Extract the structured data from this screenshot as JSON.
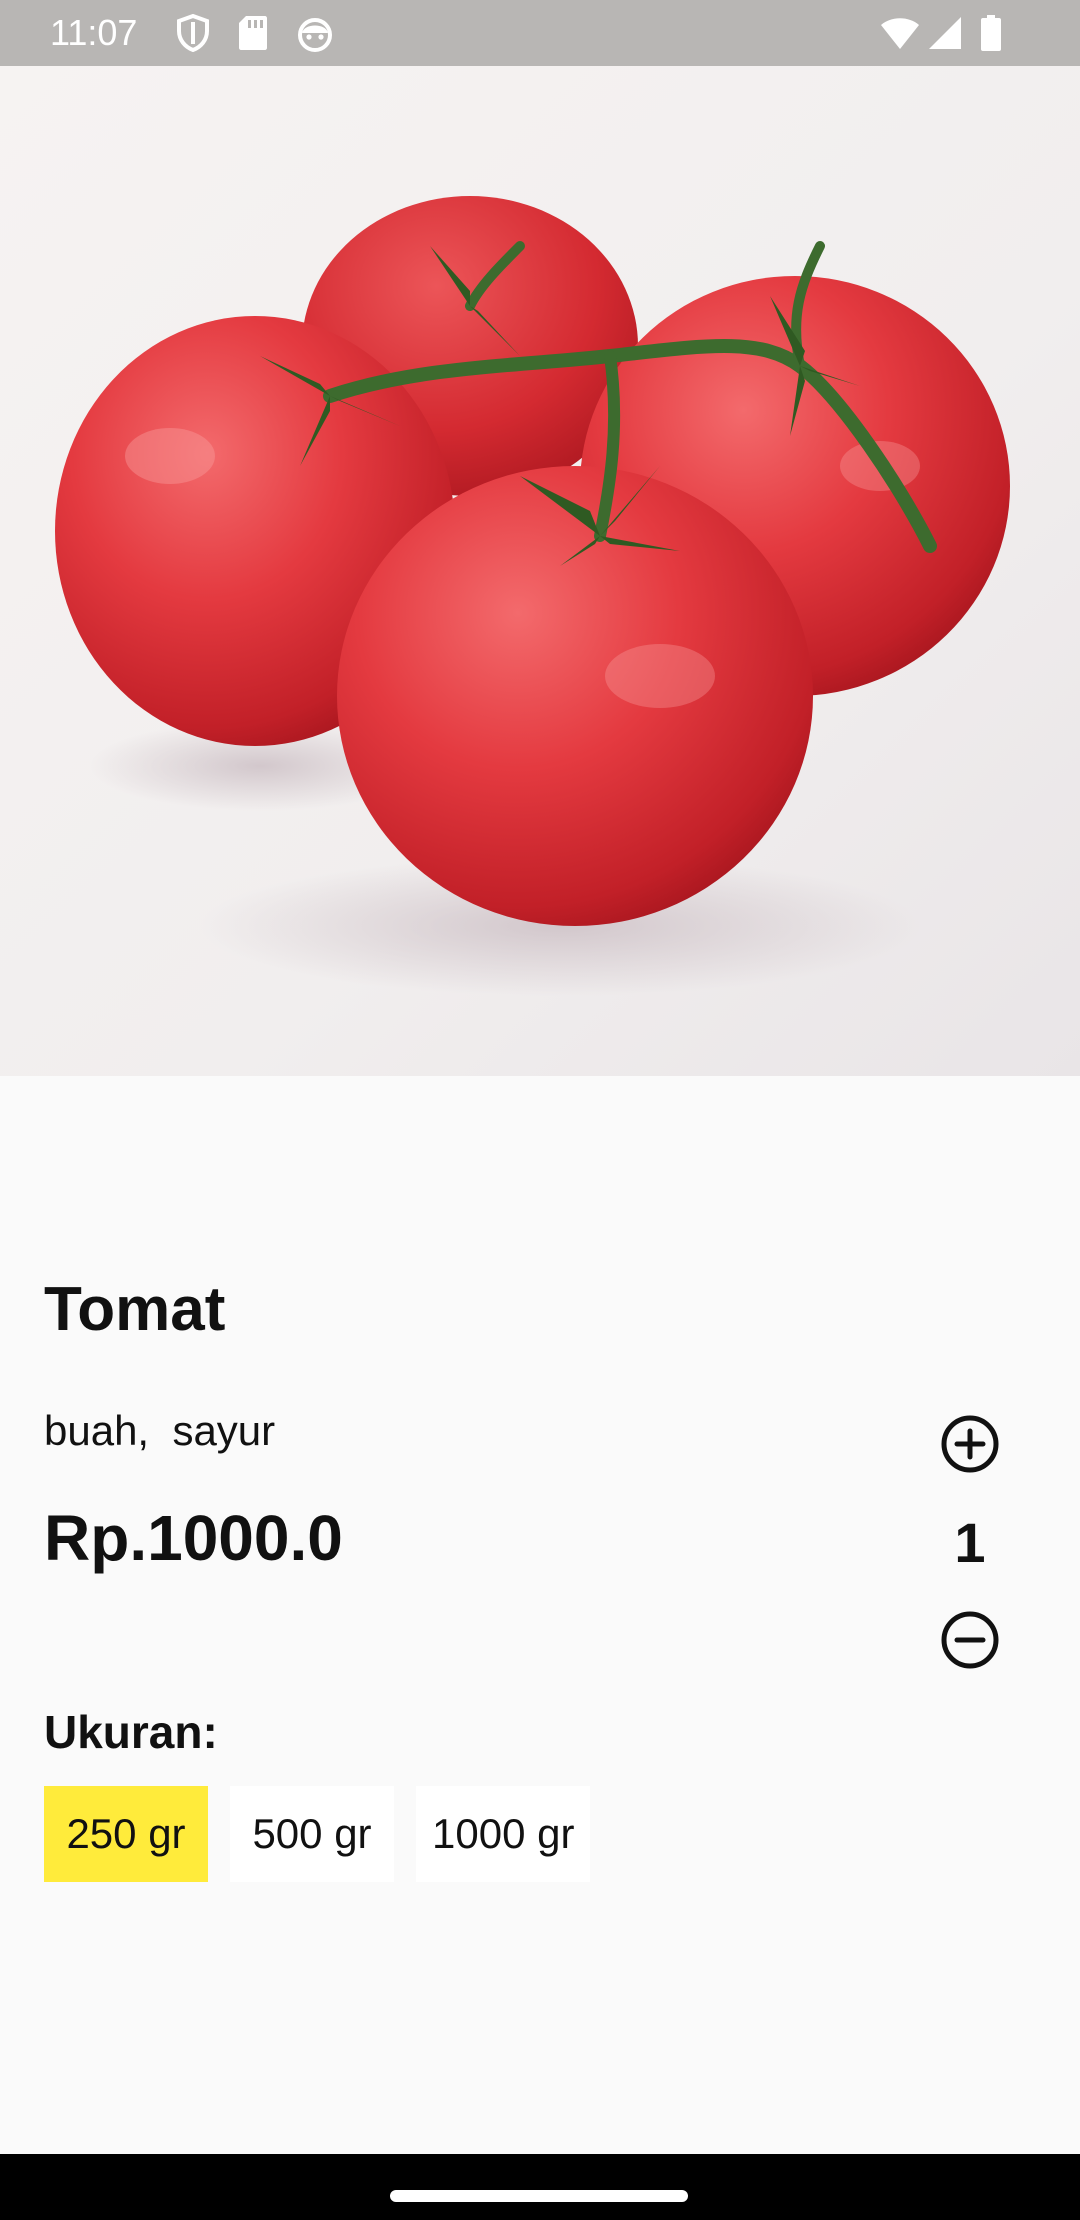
{
  "status_bar": {
    "time": "11:07",
    "left_icons": [
      "shield-icon",
      "sd-card-icon",
      "android-face-icon"
    ],
    "right_icons": [
      "wifi-icon",
      "cell-signal-icon",
      "battery-icon"
    ]
  },
  "product": {
    "image_subject": "tomatoes-image",
    "name": "Tomat",
    "categories": "buah,  sayur",
    "price": "Rp.1000.0",
    "quantity": "1",
    "quantity_icons": [
      "plus-circle-icon",
      "minus-circle-icon"
    ]
  },
  "size": {
    "label": "Ukuran:",
    "options": [
      {
        "label": "250 gr",
        "selected": true
      },
      {
        "label": "500 gr",
        "selected": false
      },
      {
        "label": "1000 gr",
        "selected": false
      }
    ],
    "selected_color": "#ffeb3b"
  },
  "colors": {
    "status_bar": "#b8b6b4",
    "background": "#fafafa",
    "nav_bar": "#000000"
  }
}
